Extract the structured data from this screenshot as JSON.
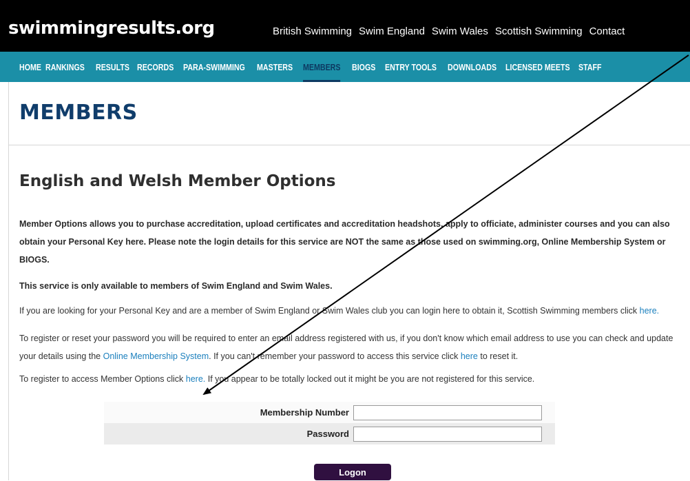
{
  "header": {
    "logo": "swimmingresults.org",
    "top_links": [
      "British Swimming",
      "Swim England",
      "Swim Wales",
      "Scottish Swimming",
      "Contact"
    ]
  },
  "nav": {
    "items": [
      "HOME",
      "RANKINGS",
      "RESULTS",
      "RECORDS",
      "PARA-SWIMMING",
      "MASTERS",
      "MEMBERS",
      "BIOGS",
      "ENTRY TOOLS",
      "DOWNLOADS",
      "LICENSED MEETS",
      "STAFF"
    ],
    "active": "MEMBERS"
  },
  "page": {
    "title": "MEMBERS",
    "section_heading": "English and Welsh Member Options",
    "intro": "Member Options allows you to purchase accreditation, upload certificates and accreditation headshots, apply to officiate, administer courses and you can also obtain your Personal Key here. Please note the login details for this service are NOT the same as those used on swimming.org, Online Membership System or BIOGS.",
    "availability": "This service is only available to members of Swim England and Swim Wales.",
    "personal_key_text": "If you are looking for your Personal Key and are a member of Swim England or Swim Wales club you can login here to obtain it, Scottish Swimming members click ",
    "personal_key_link": "here.",
    "reset_text_1": "To register or reset your password you will be required to enter an email address registered with us, if you don't know which email address to use you can check and update your details using the ",
    "reset_link_1": "Online Membership System",
    "reset_text_2": ". If you can't remember your password to access this service click ",
    "reset_link_2": "here",
    "reset_text_3": " to reset it.",
    "register_text_1": "To register to access Member Options click ",
    "register_link": "here.",
    "register_text_2": " If you appear to be totally locked out it might be you are not registered for this service."
  },
  "login": {
    "membership_label": "Membership Number",
    "membership_value": "",
    "password_label": "Password",
    "password_value": "",
    "logon_button": "Logon"
  },
  "colors": {
    "topbar": "#000000",
    "navbar": "#1b8fa7",
    "active_nav": "#0d3a62",
    "title": "#103d6b",
    "link": "#1a7fbd",
    "button": "#301040"
  }
}
